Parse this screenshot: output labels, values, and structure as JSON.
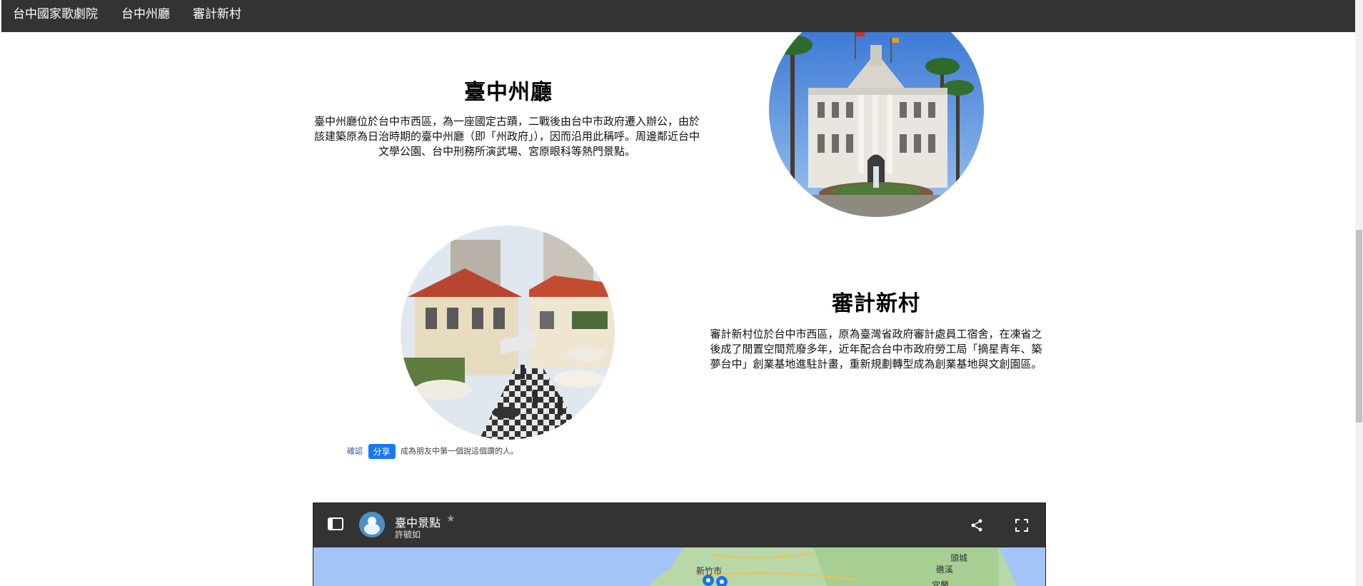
{
  "nav": {
    "items": [
      "台中國家歌劇院",
      "台中州廳",
      "審計新村"
    ]
  },
  "section1": {
    "title": "臺中州廳",
    "description": "臺中州廳位於台中市西區，為一座國定古蹟，二戰後由台中市政府遷入辦公，由於該建築原為日治時期的臺中州廳（即「州政府」），因而沿用此稱呼。周邊鄰近台中文學公園、台中刑務所演武場、宮原眼科等熱門景點。"
  },
  "section2": {
    "title": "審計新村",
    "description": "審計新村位於台中市西區，原為臺灣省政府審計處員工宿舍，在凍省之後成了閒置空間荒廢多年，近年配合台中市政府勞工局「摘星青年、築夢台中」創業基地進駐計畫，重新規劃轉型成為創業基地與文創園區。"
  },
  "facebook": {
    "confirm_label": "確認",
    "share_label": "分享",
    "note": "成為朋友中第一個說這個讚的人。"
  },
  "map": {
    "title": "臺中景點",
    "author": "許毓如",
    "labels": [
      "新竹市",
      "頭城",
      "礁溪",
      "宜蘭"
    ],
    "icons": [
      "sidebar-toggle-icon",
      "share-icon",
      "fullscreen-icon",
      "star-icon",
      "avatar"
    ]
  },
  "colors": {
    "navbar": "#333333",
    "share_button": "#1877f2",
    "map_water": "#a3c5f7"
  }
}
